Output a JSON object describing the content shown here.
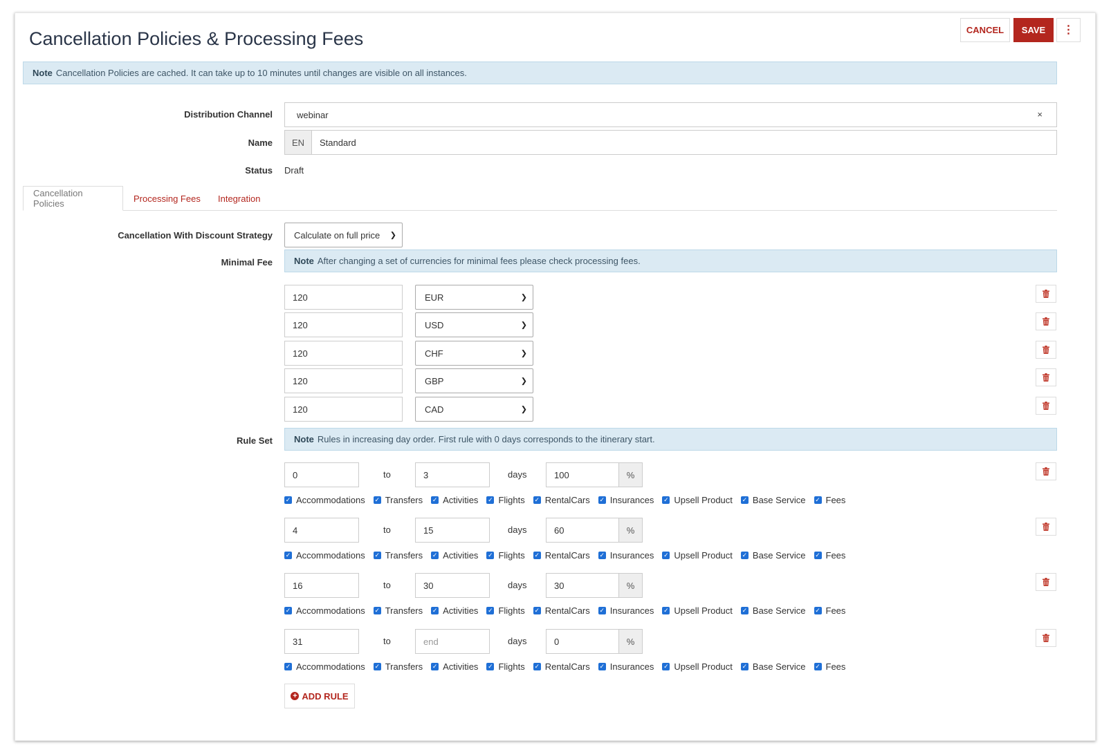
{
  "page": {
    "title": "Cancellation Policies & Processing Fees",
    "actions": {
      "cancel": "CANCEL",
      "save": "SAVE",
      "more_icon": "vertical-ellipsis-icon"
    }
  },
  "cache_note": {
    "bold": "Note",
    "text": "Cancellation Policies are cached. It can take up to 10 minutes until changes are visible on all instances."
  },
  "form": {
    "distribution_channel": {
      "label": "Distribution Channel",
      "value": "webinar",
      "clear": "×"
    },
    "name": {
      "label": "Name",
      "lang": "EN",
      "value": "Standard"
    },
    "status": {
      "label": "Status",
      "value": "Draft"
    }
  },
  "tabs": [
    {
      "label": "Cancellation Policies",
      "active": true
    },
    {
      "label": "Processing Fees",
      "active": false
    },
    {
      "label": "Integration",
      "active": false
    }
  ],
  "cancellation": {
    "strategy": {
      "label": "Cancellation With Discount Strategy",
      "value": "Calculate on full price"
    },
    "minimal_fee": {
      "label": "Minimal Fee",
      "note_bold": "Note",
      "note_text": "After changing a set of currencies for minimal fees please check processing fees.",
      "fees": [
        {
          "amount": "120",
          "currency": "EUR"
        },
        {
          "amount": "120",
          "currency": "USD"
        },
        {
          "amount": "120",
          "currency": "CHF"
        },
        {
          "amount": "120",
          "currency": "GBP"
        },
        {
          "amount": "120",
          "currency": "CAD"
        }
      ]
    },
    "rule_set": {
      "label": "Rule Set",
      "note_bold": "Note",
      "note_text": "Rules in increasing day order. First rule with 0 days corresponds to the itinerary start.",
      "to_label": "to",
      "days_label": "days",
      "percent_label": "%",
      "categories": [
        "Accommodations",
        "Transfers",
        "Activities",
        "Flights",
        "RentalCars",
        "Insurances",
        "Upsell Product",
        "Base Service",
        "Fees"
      ],
      "rules": [
        {
          "from": "0",
          "to": "3",
          "to_placeholder": "",
          "percent": "100"
        },
        {
          "from": "4",
          "to": "15",
          "to_placeholder": "",
          "percent": "60"
        },
        {
          "from": "16",
          "to": "30",
          "to_placeholder": "",
          "percent": "30"
        },
        {
          "from": "31",
          "to": "",
          "to_placeholder": "end",
          "percent": "0"
        }
      ],
      "add_rule": "ADD RULE"
    }
  },
  "colors": {
    "accent": "#b3261e",
    "note_bg": "#dbeaf3",
    "checkbox": "#1f6fd6"
  }
}
